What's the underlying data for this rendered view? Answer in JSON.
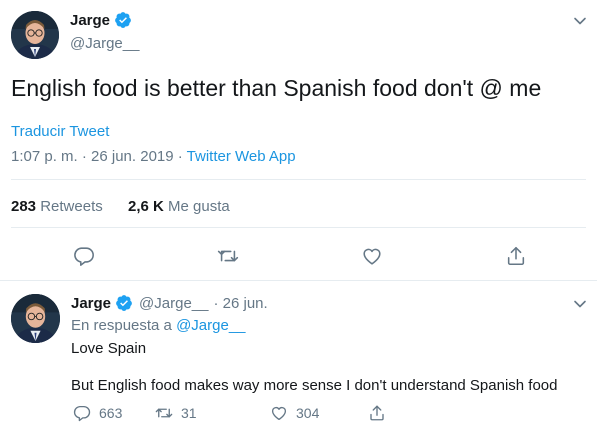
{
  "main_tweet": {
    "display_name": "Jarge",
    "handle": "@Jarge__",
    "text": "English food is better than Spanish food don't @ me",
    "translate_label": "Traducir Tweet",
    "timestamp": "1:07 p. m. · 26 jun. 2019 · ",
    "source": "Twitter Web App",
    "retweets_count": "283",
    "retweets_label": "Retweets",
    "likes_count": "2,6 K",
    "likes_label": "Me gusta"
  },
  "reply_tweet": {
    "display_name": "Jarge",
    "handle": "@Jarge__",
    "date": "· 26 jun.",
    "reply_to_label": "En respuesta a",
    "reply_to_handle": "@Jarge__",
    "line1": "Love Spain",
    "line2": "But English food makes way more sense I don't understand Spanish food",
    "reply_count": "663",
    "retweet_count": "31",
    "like_count": "304"
  },
  "icons": {
    "verified": "verified-badge-icon",
    "menu": "chevron-down-icon",
    "reply": "reply-bubble-icon",
    "retweet": "retweet-arrows-icon",
    "like": "heart-icon",
    "share": "share-upload-icon"
  },
  "colors": {
    "link": "#1b95e0",
    "muted": "#657786",
    "text": "#14171a",
    "divider": "#e6ecf0",
    "verified": "#1da1f2"
  }
}
